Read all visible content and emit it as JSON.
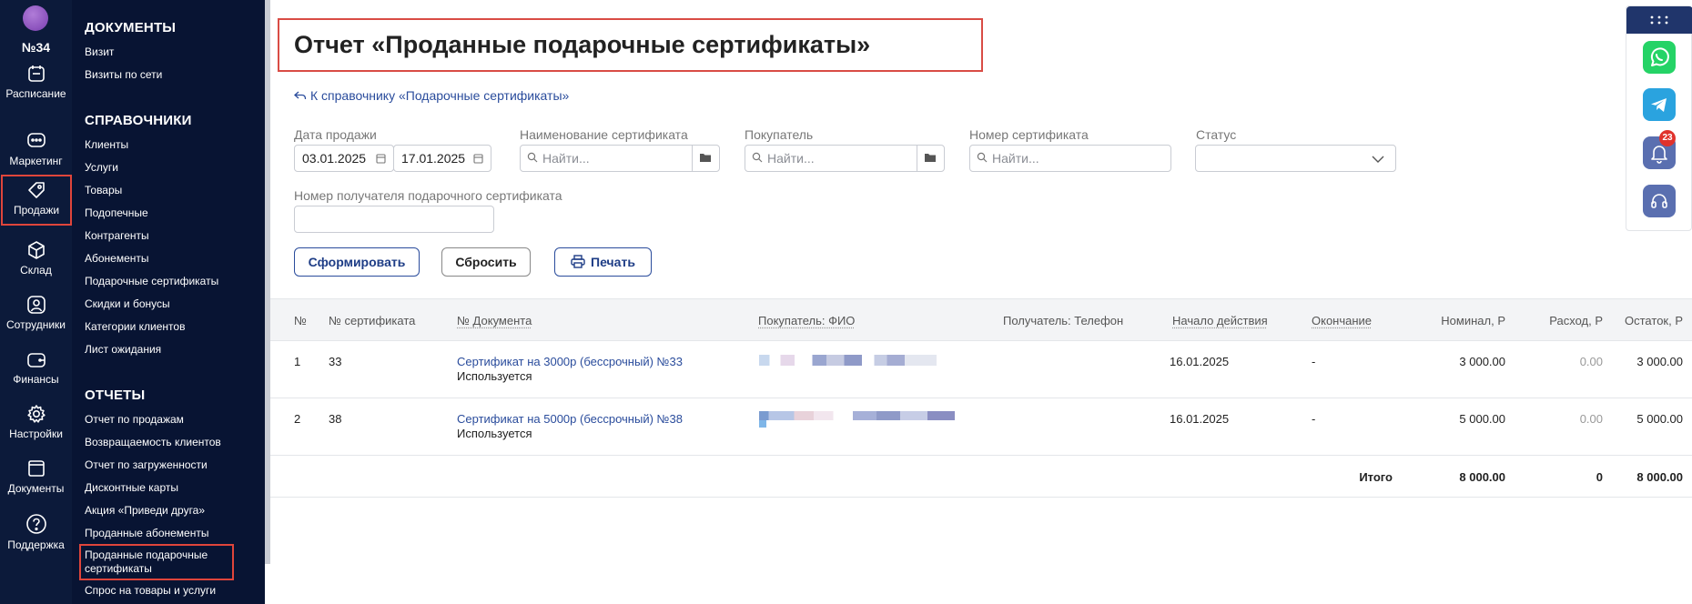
{
  "branch": {
    "number": "№34"
  },
  "rail": [
    {
      "label": "Расписание",
      "icon": "calendar-icon"
    },
    {
      "label": "Маркетинг",
      "icon": "chat-icon"
    },
    {
      "label": "Продажи",
      "icon": "tag-icon"
    },
    {
      "label": "Склад",
      "icon": "box-icon"
    },
    {
      "label": "Сотрудники",
      "icon": "user-icon"
    },
    {
      "label": "Финансы",
      "icon": "wallet-icon"
    },
    {
      "label": "Настройки",
      "icon": "gear-icon"
    },
    {
      "label": "Документы",
      "icon": "folder-icon"
    },
    {
      "label": "Поддержка",
      "icon": "question-icon"
    }
  ],
  "menu": {
    "documents": {
      "heading": "ДОКУМЕНТЫ",
      "items": [
        "Визит",
        "Визиты по сети"
      ]
    },
    "references": {
      "heading": "СПРАВОЧНИКИ",
      "items": [
        "Клиенты",
        "Услуги",
        "Товары",
        "Подопечные",
        "Контрагенты",
        "Абонементы",
        "Подарочные сертификаты",
        "Скидки и бонусы",
        "Категории клиентов",
        "Лист ожидания"
      ]
    },
    "reports": {
      "heading": "ОТЧЕТЫ",
      "items": [
        "Отчет по продажам",
        "Возвращаемость клиентов",
        "Отчет по загруженности",
        "Дисконтные карты",
        "Акция «Приведи друга»",
        "Проданные абонементы",
        "Проданные подарочные сертификаты",
        "Спрос на товары и услуги"
      ]
    }
  },
  "page": {
    "title": "Отчет «Проданные подарочные сертификаты»",
    "back_link": "К справочнику «Подарочные сертификаты»"
  },
  "filters": {
    "sale_date": {
      "label": "Дата продажи",
      "from": "03.01.2025",
      "to": "17.01.2025"
    },
    "cert_name": {
      "label": "Наименование сертификата",
      "placeholder": "Найти..."
    },
    "buyer": {
      "label": "Покупатель",
      "placeholder": "Найти..."
    },
    "cert_number": {
      "label": "Номер сертификата",
      "placeholder": "Найти..."
    },
    "status": {
      "label": "Статус",
      "value": ""
    },
    "recipient_number": {
      "label": "Номер получателя подарочного сертификата",
      "value": ""
    }
  },
  "buttons": {
    "generate": "Сформировать",
    "reset": "Сбросить",
    "print": "Печать"
  },
  "table": {
    "columns": [
      "№",
      "№ сертификата",
      "№ Документа",
      "Покупатель: ФИО",
      "Получатель: Телефон",
      "Начало действия",
      "Окончание",
      "Номинал, Р",
      "Расход, Р",
      "Остаток, Р"
    ],
    "rows": [
      {
        "n": "1",
        "cert": "33",
        "doc": "Сертификат на 3000р (бессрочный) №33",
        "doc_status": "Используется",
        "phone": "",
        "start": "16.01.2025",
        "end": "-",
        "nominal": "3 000.00",
        "spent": "0.00",
        "rest": "3 000.00"
      },
      {
        "n": "2",
        "cert": "38",
        "doc": "Сертификат на 5000р (бессрочный) №38",
        "doc_status": "Используется",
        "phone": "",
        "start": "16.01.2025",
        "end": "-",
        "nominal": "5 000.00",
        "spent": "0.00",
        "rest": "5 000.00"
      }
    ],
    "totals": {
      "label": "Итого",
      "nominal": "8 000.00",
      "spent": "0",
      "rest": "8 000.00"
    }
  },
  "widget": {
    "notifications_count": "23"
  },
  "colors": {
    "rail_bg": "#0c1a3a",
    "menu_bg": "#081433",
    "accent": "#2a4c9c",
    "highlight": "#e0453b",
    "whatsapp": "#25d366",
    "telegram": "#2aa3df",
    "widget_btn": "#5a6fb0"
  }
}
